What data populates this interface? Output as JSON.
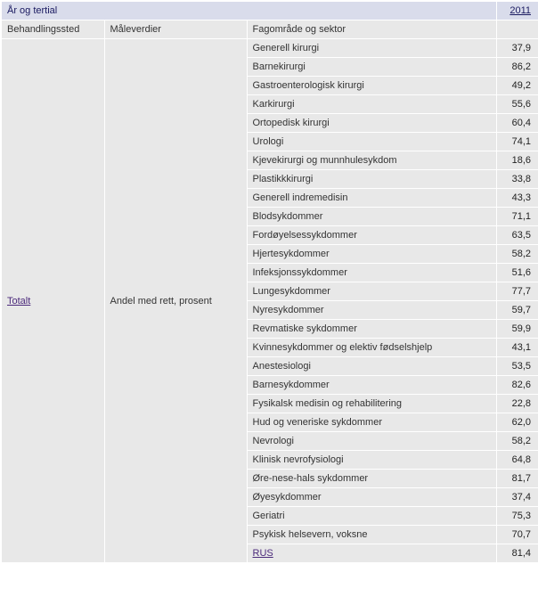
{
  "header": {
    "top_label": "År og tertial",
    "year": "2011",
    "col_labels": {
      "behandlingssted": "Behandlingssted",
      "maaleverdier": "Måleverdier",
      "fagomraade": "Fagområde og sektor"
    }
  },
  "stub": {
    "behandlingssted": "Totalt",
    "maaleverdier": "Andel med rett, prosent"
  },
  "rows": [
    {
      "label": "Generell kirurgi",
      "value": "37,9",
      "is_link": false
    },
    {
      "label": "Barnekirurgi",
      "value": "86,2",
      "is_link": false
    },
    {
      "label": "Gastroenterologisk kirurgi",
      "value": "49,2",
      "is_link": false
    },
    {
      "label": "Karkirurgi",
      "value": "55,6",
      "is_link": false
    },
    {
      "label": "Ortopedisk kirurgi",
      "value": "60,4",
      "is_link": false
    },
    {
      "label": "Urologi",
      "value": "74,1",
      "is_link": false
    },
    {
      "label": "Kjevekirurgi og munnhulesykdom",
      "value": "18,6",
      "is_link": false
    },
    {
      "label": "Plastikkkirurgi",
      "value": "33,8",
      "is_link": false
    },
    {
      "label": "Generell indremedisin",
      "value": "43,3",
      "is_link": false
    },
    {
      "label": "Blodsykdommer",
      "value": "71,1",
      "is_link": false
    },
    {
      "label": "Fordøyelsessykdommer",
      "value": "63,5",
      "is_link": false
    },
    {
      "label": "Hjertesykdommer",
      "value": "58,2",
      "is_link": false
    },
    {
      "label": "Infeksjonssykdommer",
      "value": "51,6",
      "is_link": false
    },
    {
      "label": "Lungesykdommer",
      "value": "77,7",
      "is_link": false
    },
    {
      "label": "Nyresykdommer",
      "value": "59,7",
      "is_link": false
    },
    {
      "label": "Revmatiske sykdommer",
      "value": "59,9",
      "is_link": false
    },
    {
      "label": "Kvinnesykdommer og elektiv fødselshjelp",
      "value": "43,1",
      "is_link": false
    },
    {
      "label": "Anestesiologi",
      "value": "53,5",
      "is_link": false
    },
    {
      "label": "Barnesykdommer",
      "value": "82,6",
      "is_link": false
    },
    {
      "label": "Fysikalsk medisin og rehabilitering",
      "value": "22,8",
      "is_link": false
    },
    {
      "label": "Hud og veneriske sykdommer",
      "value": "62,0",
      "is_link": false
    },
    {
      "label": "Nevrologi",
      "value": "58,2",
      "is_link": false
    },
    {
      "label": "Klinisk nevrofysiologi",
      "value": "64,8",
      "is_link": false
    },
    {
      "label": "Øre-nese-hals sykdommer",
      "value": "81,7",
      "is_link": false
    },
    {
      "label": "Øyesykdommer",
      "value": "37,4",
      "is_link": false
    },
    {
      "label": "Geriatri",
      "value": "75,3",
      "is_link": false
    },
    {
      "label": "Psykisk helsevern, voksne",
      "value": "70,7",
      "is_link": false
    },
    {
      "label": "RUS",
      "value": "81,4",
      "is_link": true
    }
  ]
}
